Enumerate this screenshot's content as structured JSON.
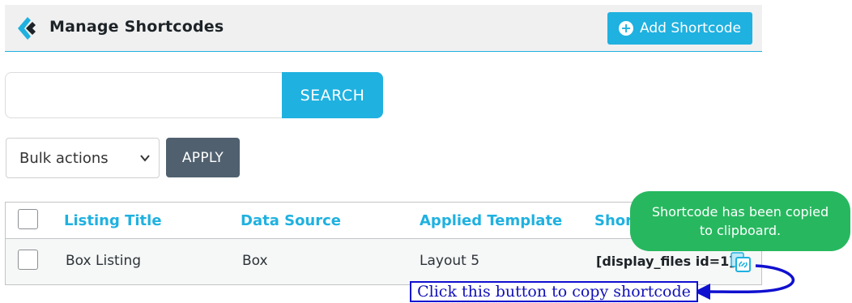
{
  "header": {
    "title": "Manage Shortcodes",
    "add_button_label": "Add Shortcode",
    "accent_color": "#1fb1e0"
  },
  "search": {
    "value": "",
    "placeholder": "",
    "button_label": "SEARCH"
  },
  "bulk": {
    "selected": "Bulk actions",
    "apply_label": "APPLY"
  },
  "table": {
    "columns": [
      "Listing Title",
      "Data Source",
      "Applied Template",
      "Shortcode"
    ],
    "visible_header_fragment": "Short",
    "rows": [
      {
        "listing_title": "Box Listing",
        "data_source": "Box",
        "applied_template": "Layout 5",
        "shortcode": "[display_files id=1]"
      }
    ]
  },
  "toast": {
    "text": "Shortcode has been copied to clipboard.",
    "color": "#27b85f"
  },
  "annotation": {
    "text": "Click this button to copy shortcode",
    "color": "#1010d0"
  },
  "icons": [
    "brand-logo-icon",
    "plus-circle-icon",
    "chevron-down-icon",
    "copy-link-icon",
    "annotation-arrow"
  ]
}
